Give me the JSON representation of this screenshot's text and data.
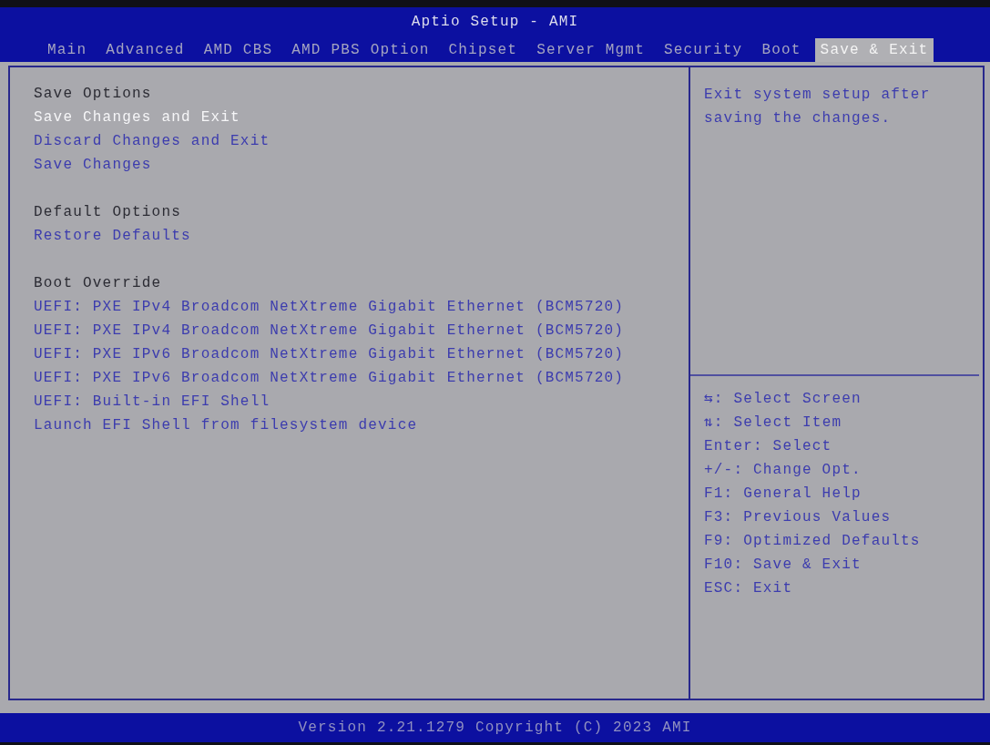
{
  "window": {
    "title": "Aptio Setup - AMI"
  },
  "tabs": [
    {
      "label": "Main",
      "selected": false
    },
    {
      "label": "Advanced",
      "selected": false
    },
    {
      "label": "AMD CBS",
      "selected": false
    },
    {
      "label": "AMD PBS Option",
      "selected": false
    },
    {
      "label": "Chipset",
      "selected": false
    },
    {
      "label": "Server Mgmt",
      "selected": false
    },
    {
      "label": "Security",
      "selected": false
    },
    {
      "label": "Boot",
      "selected": false
    },
    {
      "label": "Save & Exit",
      "selected": true
    }
  ],
  "menu": {
    "sections": [
      {
        "title": "Save Options",
        "items": [
          {
            "label": "Save Changes and Exit",
            "selected": true
          },
          {
            "label": "Discard Changes and Exit",
            "selected": false
          },
          {
            "label": "Save Changes",
            "selected": false
          }
        ]
      },
      {
        "title": "Default Options",
        "items": [
          {
            "label": "Restore Defaults",
            "selected": false
          }
        ]
      },
      {
        "title": "Boot Override",
        "items": [
          {
            "label": "UEFI: PXE IPv4 Broadcom NetXtreme Gigabit Ethernet (BCM5720)",
            "selected": false
          },
          {
            "label": "UEFI: PXE IPv4 Broadcom NetXtreme Gigabit Ethernet (BCM5720)",
            "selected": false
          },
          {
            "label": "UEFI: PXE IPv6 Broadcom NetXtreme Gigabit Ethernet (BCM5720)",
            "selected": false
          },
          {
            "label": "UEFI: PXE IPv6 Broadcom NetXtreme Gigabit Ethernet (BCM5720)",
            "selected": false
          },
          {
            "label": "UEFI: Built-in EFI Shell",
            "selected": false
          },
          {
            "label": "Launch EFI Shell from filesystem device",
            "selected": false
          }
        ]
      }
    ]
  },
  "help": {
    "description": "Exit system setup after saving the changes.",
    "keys": [
      "⇆: Select Screen",
      "⇅: Select Item",
      "Enter: Select",
      "+/-: Change Opt.",
      "F1: General Help",
      "F3: Previous Values",
      "F9: Optimized Defaults",
      "F10: Save & Exit",
      "ESC: Exit"
    ]
  },
  "status_bar": {
    "text": "Version 2.21.1279 Copyright (C) 2023 AMI"
  }
}
